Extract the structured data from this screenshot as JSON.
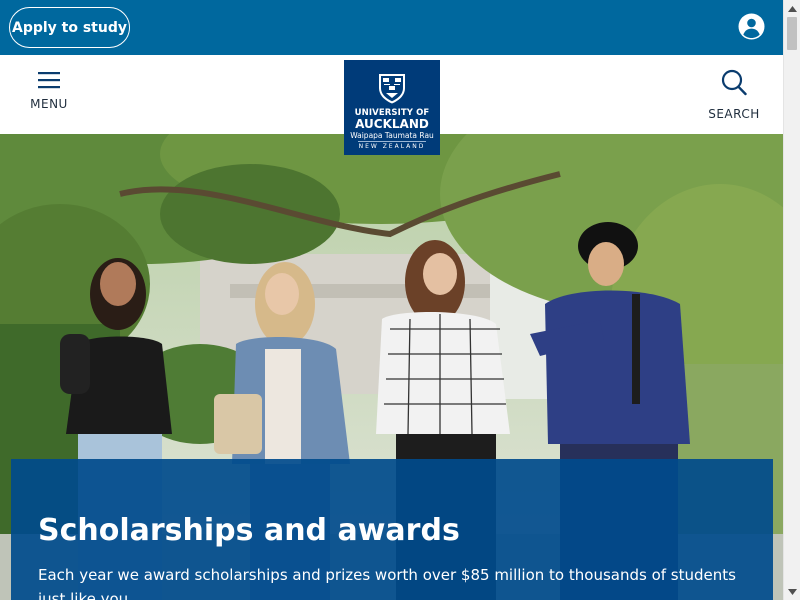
{
  "topbar": {
    "apply_label": "Apply to study",
    "account_icon": "user-account-icon"
  },
  "header": {
    "menu_label": "MENU",
    "menu_icon": "hamburger-menu-icon",
    "search_label": "SEARCH",
    "search_icon": "magnifier-search-icon",
    "logo": {
      "line1": "UNIVERSITY OF",
      "line2": "AUCKLAND",
      "line3": "Waipapa Taumata Rau",
      "line4": "NEW ZEALAND"
    }
  },
  "hero": {
    "title": "Scholarships and awards",
    "text": "Each year we award scholarships and prizes worth over $85 million to thousands of students just like you."
  },
  "colors": {
    "topbar": "#00689e",
    "logo_bg": "#003b79",
    "hero_panel": "#004b8c"
  }
}
